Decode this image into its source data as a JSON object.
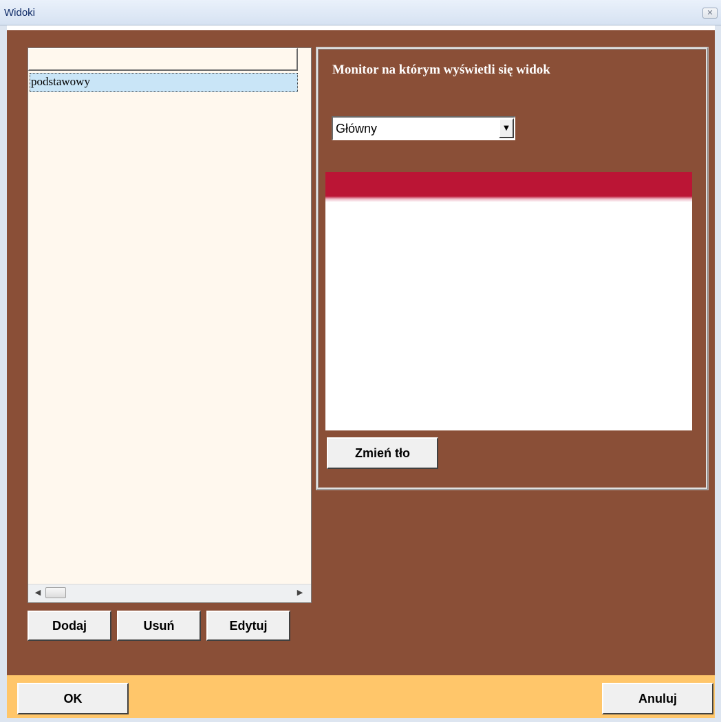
{
  "window": {
    "title": "Widoki",
    "close_symbol": "✕"
  },
  "views_list": {
    "header_text": "",
    "items": [
      "podstawowy"
    ],
    "selected_index": 0,
    "scroll_left_symbol": "◀",
    "scroll_right_symbol": "▶"
  },
  "list_buttons": {
    "add": "Dodaj",
    "remove": "Usuń",
    "edit": "Edytuj"
  },
  "monitor": {
    "label": "Monitor na którym wyświetli się widok",
    "selected": "Główny",
    "dropdown_symbol": "▼"
  },
  "preview": {
    "change_background_label": "Zmień tło",
    "header_color": "#bb1535"
  },
  "footer": {
    "ok": "OK",
    "cancel": "Anuluj"
  },
  "colors": {
    "client_background": "#8a4f37",
    "footer_background": "#ffc66a",
    "list_background": "#fff8ee",
    "selection": "#c9e5f7"
  }
}
